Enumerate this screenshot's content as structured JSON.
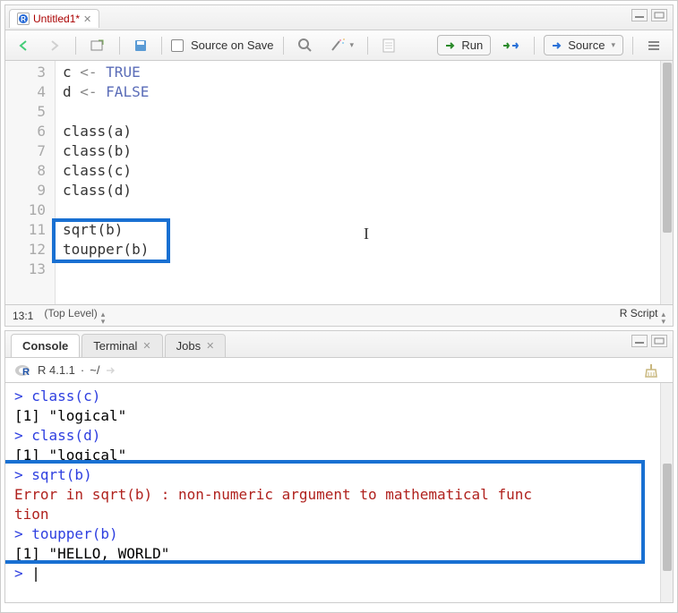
{
  "editor": {
    "tab_title": "Untitled1*",
    "source_on_save_label": "Source on Save",
    "run_label": "Run",
    "source_label": "Source",
    "cursor_pos": "13:1",
    "scope": "(Top Level)",
    "lang": "R Script",
    "lines": [
      {
        "n": 3,
        "tokens": [
          {
            "t": "c ",
            "c": ""
          },
          {
            "t": "<- ",
            "c": "op"
          },
          {
            "t": "TRUE",
            "c": "kw-val"
          }
        ]
      },
      {
        "n": 4,
        "tokens": [
          {
            "t": "d ",
            "c": ""
          },
          {
            "t": "<- ",
            "c": "op"
          },
          {
            "t": "FALSE",
            "c": "kw-val"
          }
        ]
      },
      {
        "n": 5,
        "tokens": []
      },
      {
        "n": 6,
        "tokens": [
          {
            "t": "class(a)",
            "c": ""
          }
        ]
      },
      {
        "n": 7,
        "tokens": [
          {
            "t": "class(b)",
            "c": ""
          }
        ]
      },
      {
        "n": 8,
        "tokens": [
          {
            "t": "class(c)",
            "c": ""
          }
        ]
      },
      {
        "n": 9,
        "tokens": [
          {
            "t": "class(d)",
            "c": ""
          }
        ]
      },
      {
        "n": 10,
        "tokens": []
      },
      {
        "n": 11,
        "tokens": [
          {
            "t": "sqrt(b)",
            "c": ""
          }
        ]
      },
      {
        "n": 12,
        "tokens": [
          {
            "t": "toupper(b)",
            "c": ""
          }
        ]
      },
      {
        "n": 13,
        "tokens": []
      }
    ]
  },
  "console": {
    "tabs": {
      "console": "Console",
      "terminal": "Terminal",
      "jobs": "Jobs"
    },
    "version": "R 4.1.1",
    "path": "~/",
    "lines": [
      {
        "type": "cmd",
        "text": "class(c)"
      },
      {
        "type": "out",
        "text": "[1] \"logical\""
      },
      {
        "type": "cmd",
        "text": "class(d)"
      },
      {
        "type": "out",
        "text": "[1] \"logical\""
      },
      {
        "type": "cmd",
        "text": "sqrt(b)"
      },
      {
        "type": "err",
        "text": "Error in sqrt(b) : non-numeric argument to mathematical func"
      },
      {
        "type": "err",
        "text": "tion"
      },
      {
        "type": "cmd",
        "text": "toupper(b)"
      },
      {
        "type": "out",
        "text": "[1] \"HELLO, WORLD\""
      },
      {
        "type": "cmd",
        "text": ""
      }
    ]
  }
}
